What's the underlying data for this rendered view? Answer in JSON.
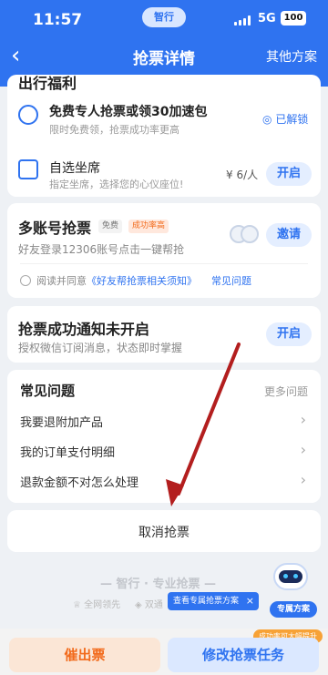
{
  "status_bar": {
    "time": "11:57",
    "app_pill": "智行",
    "network": "5G",
    "battery": "100"
  },
  "nav": {
    "title": "抢票详情",
    "more_label": "其他方案",
    "back_icon": "chevron-left-icon"
  },
  "welfare": {
    "title": "出行福利",
    "items": [
      {
        "title": "免费专人抢票或领30加速包",
        "sub": "限时免费领，抢票成功率更高",
        "status": "已解锁"
      },
      {
        "title": "自选坐席",
        "sub": "指定坐席，选择您的心仪座位!",
        "price": "¥ 6/人",
        "button": "开启"
      }
    ]
  },
  "multi_account": {
    "title": "多账号抢票",
    "tag_free": "免费",
    "tag_rate": "成功率高",
    "sub": "好友登录12306账号点击一键帮抢",
    "button": "邀请",
    "agree_prefix": "阅读并同意",
    "agree_link": "《好友帮抢票相关须知》",
    "faq_link": "常见问题"
  },
  "notify": {
    "title": "抢票成功通知未开启",
    "sub": "授权微信订阅消息，状态即时掌握",
    "button": "开启"
  },
  "faq": {
    "title": "常见问题",
    "more": "更多问题",
    "items": [
      "我要退附加产品",
      "我的订单支付明细",
      "退款金额不对怎么处理"
    ]
  },
  "cancel": {
    "label": "取消抢票"
  },
  "brand": {
    "slogan": "— 智行 · 专业抢票 —",
    "features": [
      "全网领先",
      "双通"
    ],
    "tooltip": "查看专属抢票方案",
    "bot_badge": "专属方案",
    "rate_badge": "成功率可大幅提升"
  },
  "bottom": {
    "left_button": "催出票",
    "right_button": "修改抢票任务"
  },
  "colors": {
    "primary": "#2f73f0",
    "orange": "#f26a1b",
    "background": "#eef1f5",
    "annotation_arrow": "#b31e1e"
  }
}
